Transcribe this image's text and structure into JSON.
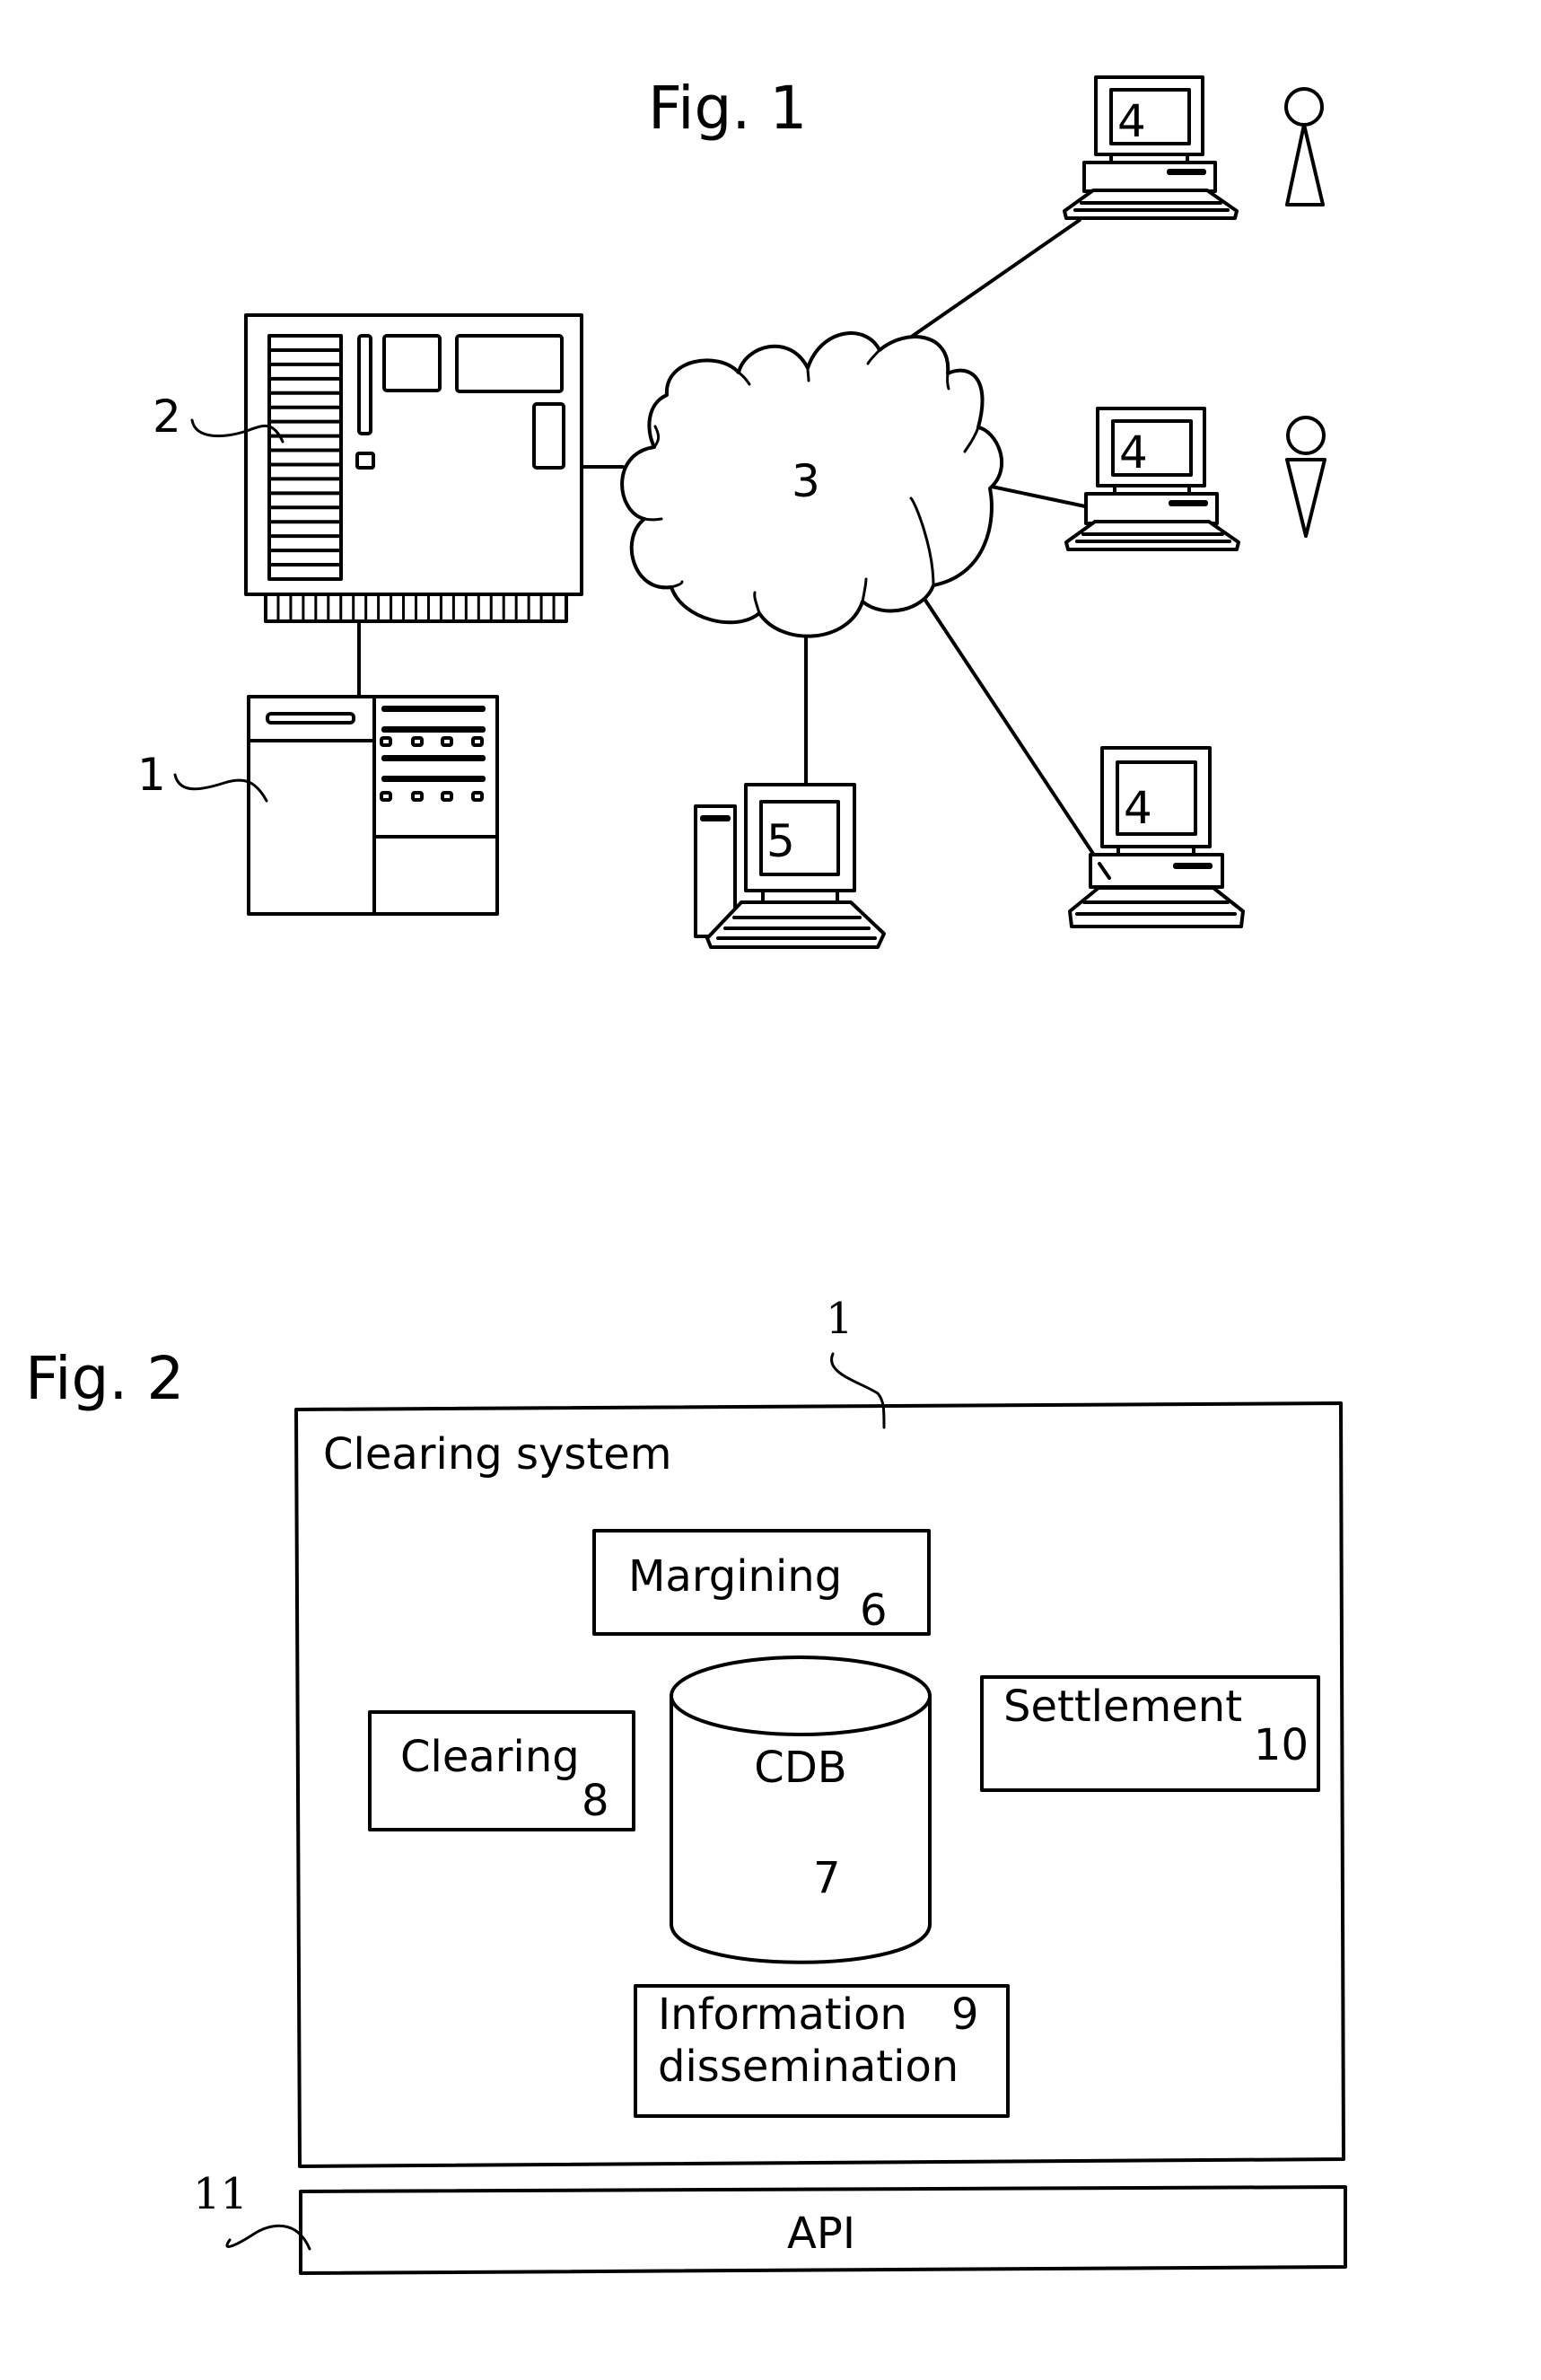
{
  "figure1": {
    "title": "Fig. 1",
    "labels": {
      "clearing_system_ref": "1",
      "server_ref": "2",
      "network_ref": "3",
      "workstation_ref": "4",
      "terminal_ref": "5"
    },
    "nodes": [
      {
        "id": "clearing-system",
        "ref": "1",
        "icon": "mainframe-icon"
      },
      {
        "id": "server",
        "ref": "2",
        "icon": "server-board-icon"
      },
      {
        "id": "network",
        "ref": "3",
        "icon": "cloud-icon"
      },
      {
        "id": "workstation-a",
        "ref": "4",
        "icon": "desktop-computer-icon",
        "user": "person-icon"
      },
      {
        "id": "workstation-b",
        "ref": "4",
        "icon": "desktop-computer-icon",
        "user": "person-icon"
      },
      {
        "id": "workstation-c",
        "ref": "4",
        "icon": "desktop-computer-icon"
      },
      {
        "id": "terminal",
        "ref": "5",
        "icon": "tower-computer-icon"
      }
    ],
    "edges": [
      [
        "server",
        "clearing-system"
      ],
      [
        "server",
        "network"
      ],
      [
        "network",
        "workstation-a"
      ],
      [
        "network",
        "workstation-b"
      ],
      [
        "network",
        "workstation-c"
      ],
      [
        "network",
        "terminal"
      ]
    ]
  },
  "figure2": {
    "title": "Fig. 2",
    "system_ref": "1",
    "system_title": "Clearing system",
    "modules": {
      "margining": {
        "label": "Margining",
        "ref": "6"
      },
      "cdb": {
        "label": "CDB",
        "ref": "7"
      },
      "clearing": {
        "label": "Clearing",
        "ref": "8"
      },
      "information": {
        "label_line1": "Information",
        "label_line2": "dissemination",
        "ref": "9"
      },
      "settlement": {
        "label": "Settlement",
        "ref": "10"
      }
    },
    "api": {
      "label": "API",
      "ref": "11"
    }
  }
}
